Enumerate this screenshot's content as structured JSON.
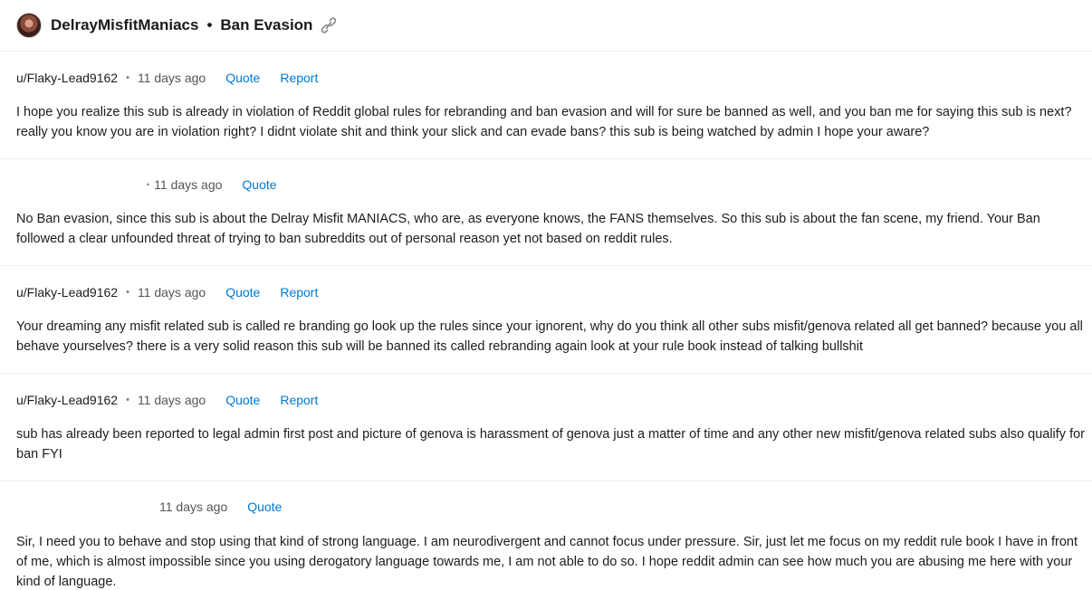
{
  "header": {
    "subreddit": "DelrayMisfitManiacs",
    "separator": "•",
    "thread_title": "Ban Evasion",
    "icons": [
      "avatar",
      "link-icon"
    ]
  },
  "messages": [
    {
      "user": "u/Flaky-Lead9162",
      "bullet": "•",
      "time": "11 days ago",
      "quote_label": "Quote",
      "report_label": "Report",
      "text": "I hope you realize this sub is already in violation of Reddit global rules for rebranding and ban evasion and will for sure be banned as well, and you ban me for saying this sub is next? really you know you are in violation right? I didnt violate shit and think your slick and can evade bans? this sub is being watched by admin I hope your aware?"
    },
    {
      "user": "",
      "bullet": "•",
      "time": "11 days ago",
      "quote_label": "Quote",
      "report_label": "",
      "text": "No Ban evasion, since this sub is about the Delray Misfit MANIACS, who are, as everyone knows, the FANS themselves. So this sub is about the fan scene, my friend. Your Ban followed a clear unfounded threat of trying to ban subreddits out of personal reason yet not based on reddit rules."
    },
    {
      "user": "u/Flaky-Lead9162",
      "bullet": "•",
      "time": "11 days ago",
      "quote_label": "Quote",
      "report_label": "Report",
      "text": "Your dreaming any misfit related sub is called re branding go look up the rules since your ignorent, why do you think all other subs misfit/genova related all get banned? because you all behave yourselves? there is a very solid reason this sub will be banned its called rebranding again look at your rule book instead of talking bullshit"
    },
    {
      "user": "u/Flaky-Lead9162",
      "bullet": "•",
      "time": "11 days ago",
      "quote_label": "Quote",
      "report_label": "Report",
      "text": "sub has already been reported to legal admin first post and picture of genova is harassment of genova just a matter of time and any other new misfit/genova related subs also qualify for ban FYI"
    },
    {
      "user": "",
      "bullet": "",
      "time": "11 days ago",
      "quote_label": "Quote",
      "report_label": "",
      "text": "Sir, I need you to behave and stop using that kind of strong language. I am neurodivergent and cannot focus under pressure. Sir, just let me focus on my reddit rule book I have in front of me, which is almost impossible since you using derogatory language towards me, I am not able to do so. I hope reddit admin can see how much you are abusing me here with your kind of language."
    }
  ]
}
